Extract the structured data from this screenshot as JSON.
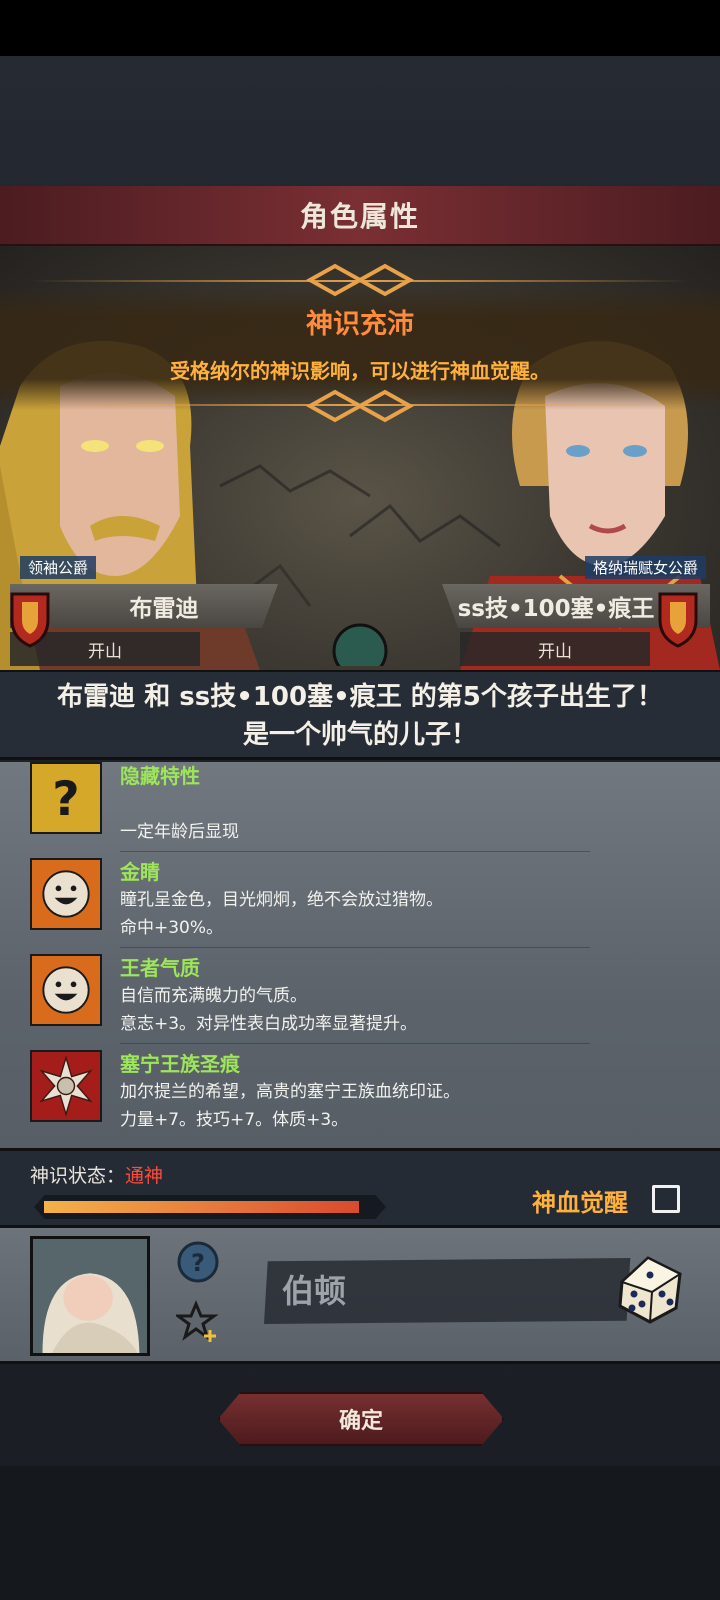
{
  "dialog": {
    "title": "角色属性"
  },
  "banner": {
    "title": "神识充沛",
    "description": "受格纳尔的神识影响，可以进行神血觉醒。"
  },
  "father": {
    "rank": "领袖公爵",
    "name": "布雷迪",
    "sub": "开山"
  },
  "mother": {
    "rank": "格纳瑞赋女公爵",
    "name": "ss技•100塞•痕王",
    "sub": "开山"
  },
  "birth": {
    "line1": "布雷迪 和 ss技•100塞•痕王 的第5个孩子出生了！",
    "line2": "是一个帅气的儿子！"
  },
  "traits": [
    {
      "name": "隐藏特性",
      "desc1": "",
      "desc2": "一定年龄后显现",
      "icon": "question-mark-icon"
    },
    {
      "name": "金睛",
      "desc1": "瞳孔呈金色，目光炯炯，绝不会放过猎物。",
      "desc2": "命中+30%。",
      "icon": "smiling-face-icon"
    },
    {
      "name": "王者气质",
      "desc1": "自信而充满魄力的气质。",
      "desc2": "意志+3。对异性表白成功率显著提升。",
      "icon": "smiling-face-icon"
    },
    {
      "name": "塞宁王族圣痕",
      "desc1": "加尔提兰的希望，高贵的塞宁王族血统印证。",
      "desc2": "力量+7。技巧+7。体质+3。",
      "icon": "sun-sigil-icon"
    }
  ],
  "status": {
    "label": "神识状态：",
    "value": "通神",
    "progress": 0.95,
    "awaken_label": "神血觉醒",
    "awaken_checked": false
  },
  "child": {
    "name_placeholder": "伯顿"
  },
  "confirm_label": "确定",
  "colors": {
    "trait_name": "#9de55a",
    "status_value": "#ff4b3b",
    "banner_title": "#ff8b3d",
    "accent_gold": "#ffb13e",
    "title_bar": "#7a2f34"
  }
}
